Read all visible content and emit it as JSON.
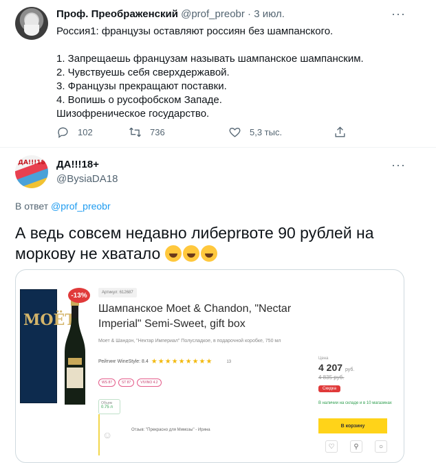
{
  "tweet1": {
    "author_name": "Проф. Преображенский",
    "handle": "@prof_preobr",
    "separator": "·",
    "time": "3 июл.",
    "more": "···",
    "lines": [
      "Россия1: французы оставляют россиян без шампанского.",
      "",
      "1. Запрещаешь французам называть шампанское шампанским.",
      "2. Чувствуешь себя сверхдержавой.",
      "3. Французы прекращают поставки.",
      "4. Вопишь о русофобском Западе.",
      "Шизофреническое государство."
    ],
    "replies": "102",
    "retweets": "736",
    "likes": "5,3 тыс."
  },
  "tweet2": {
    "author_name": "ДА!!!18+",
    "handle": "@BysiaDA18",
    "more": "···",
    "reply_prefix": "В ответ",
    "reply_mention": "@prof_preobr",
    "text": "А ведь совсем недавно либерrвоте 90 рублей на моркову не хватало",
    "emoji_count": 3,
    "avatar_tag": "ДА!!!18"
  },
  "product": {
    "discount_badge": "-13%",
    "article": "Артикул: 612687",
    "title": "Шампанское Moet & Chandon, \"Nectar Imperial\" Semi-Sweet, gift box",
    "subtitle": "Моет & Шандон, \"Нектар Империал\" Полусладкое, в подарочной коробке, 750 мл",
    "rating_label": "Рейтинг WineStyle: 8.4",
    "stars": "★★★★★★★★★",
    "rating_count": "13",
    "chips": [
      "WS 87",
      "ST 87",
      "VIVINO 4.2"
    ],
    "volume_label": "Объем",
    "volume_value": "0.75 л",
    "review": "Отзыв: \"Прекрасно для Мимозы\" - Ирина",
    "price_label": "Цена",
    "price": "4 207",
    "price_unit": "руб.",
    "old_price": "4 835 руб.",
    "sale_label": "Скидка",
    "stock": "В наличии на складе и в 10 магазинах",
    "cart_button": "В корзину",
    "box_brand": "MOËT"
  },
  "colors": {
    "link": "#1d9bf0",
    "muted": "#536471",
    "cart": "#ffd319",
    "sale": "#e03a3a"
  }
}
